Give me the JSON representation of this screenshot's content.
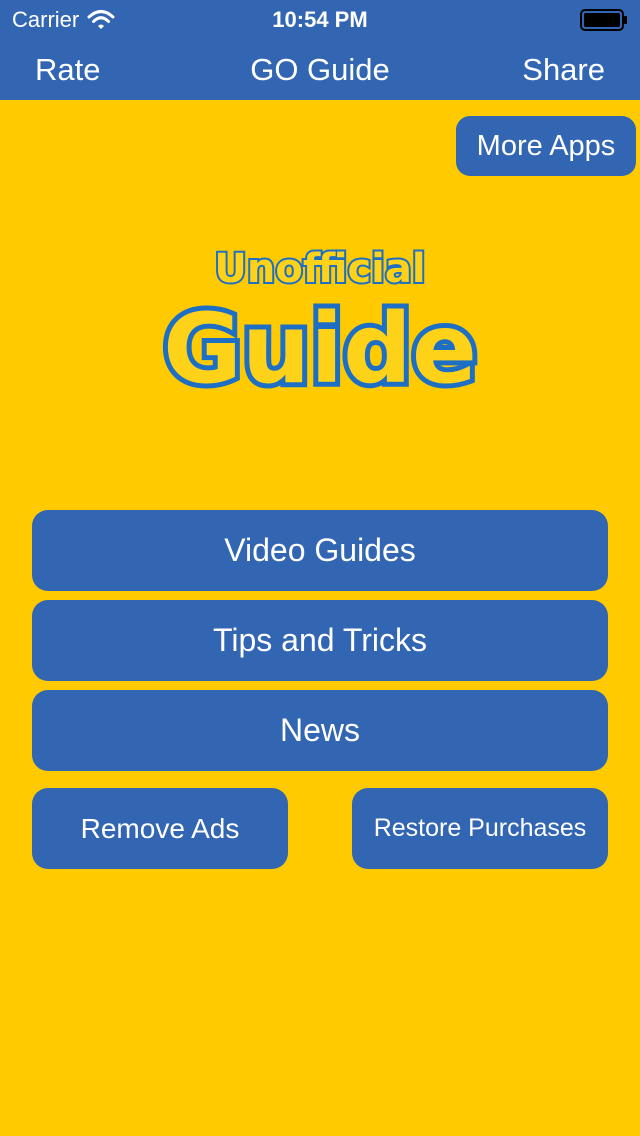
{
  "status_bar": {
    "carrier": "Carrier",
    "time": "10:54 PM",
    "wifi_icon": "wifi-icon",
    "battery_icon": "battery-icon"
  },
  "nav_bar": {
    "left_label": "Rate",
    "title": "GO Guide",
    "right_label": "Share"
  },
  "logo": {
    "line1": "Unofficial",
    "line2": "Guide"
  },
  "buttons": {
    "more_apps": "More Apps",
    "video_guides": "Video Guides",
    "tips_and_tricks": "Tips and Tricks",
    "news": "News",
    "remove_ads": "Remove Ads",
    "restore_purchases": "Restore Purchases"
  },
  "colors": {
    "background": "#ffca00",
    "primary": "#3366b2",
    "text_on_primary": "#ffffff",
    "logo_fill": "#ffd21a",
    "logo_stroke": "#1c6fc4"
  }
}
